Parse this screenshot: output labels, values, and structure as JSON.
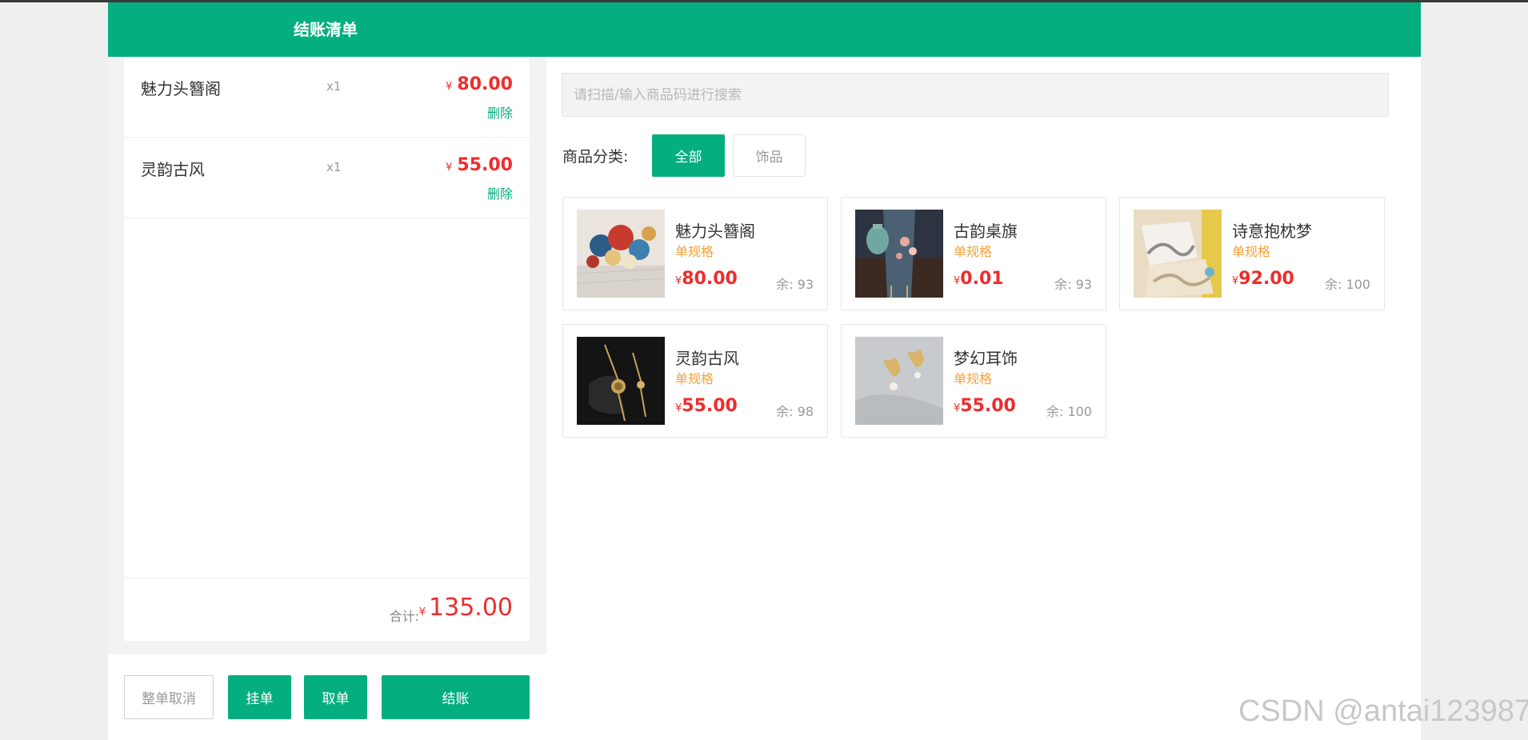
{
  "header": {
    "title": "结账清单"
  },
  "cart": {
    "items": [
      {
        "name": "魅力头簪阁",
        "qty": "x1",
        "currency": "¥",
        "price": "80.00",
        "delete_label": "删除"
      },
      {
        "name": "灵韵古风",
        "qty": "x1",
        "currency": "¥",
        "price": "55.00",
        "delete_label": "删除"
      }
    ],
    "total_label": "合计:",
    "total_currency": "¥",
    "total_value": "135.00"
  },
  "actions": {
    "cancel_all": "整单取消",
    "hold": "挂单",
    "take": "取单",
    "checkout": "结账"
  },
  "search": {
    "placeholder": "请扫描/输入商品码进行搜索",
    "value": ""
  },
  "categories": {
    "label": "商品分类:",
    "options": [
      "全部",
      "饰品"
    ],
    "selected": "全部"
  },
  "products": [
    {
      "name": "魅力头簪阁",
      "spec": "单规格",
      "currency": "¥",
      "price": "80.00",
      "stock": "余: 93"
    },
    {
      "name": "古韵桌旗",
      "spec": "单规格",
      "currency": "¥",
      "price": "0.01",
      "stock": "余: 93"
    },
    {
      "name": "诗意抱枕梦",
      "spec": "单规格",
      "currency": "¥",
      "price": "92.00",
      "stock": "余: 100"
    },
    {
      "name": "灵韵古风",
      "spec": "单规格",
      "currency": "¥",
      "price": "55.00",
      "stock": "余: 98"
    },
    {
      "name": "梦幻耳饰",
      "spec": "单规格",
      "currency": "¥",
      "price": "55.00",
      "stock": "余: 100"
    }
  ],
  "watermark": "CSDN @antai123987",
  "colors": {
    "accent": "#05ae7e",
    "price": "#ef2c2c",
    "spec": "#f5a13a"
  }
}
